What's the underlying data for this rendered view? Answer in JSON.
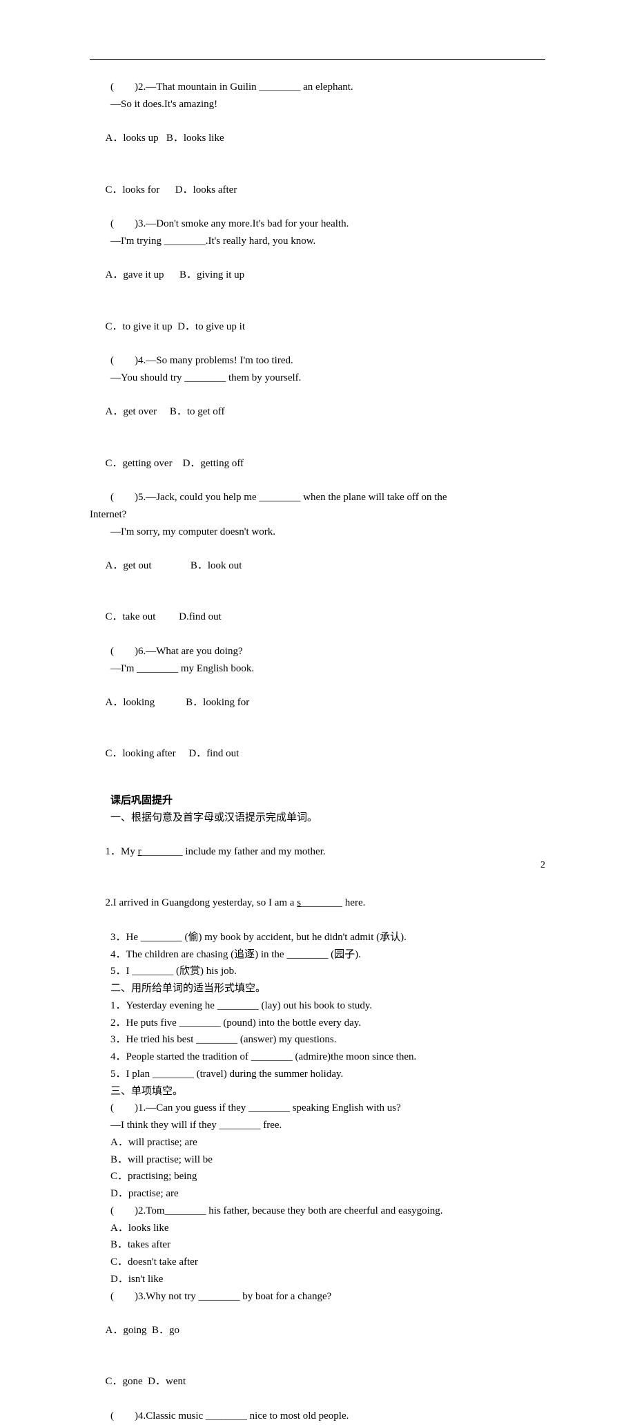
{
  "page_number": "2",
  "section_a": {
    "q2": {
      "stem": "(　　)2.—That mountain in Guilin ________ an elephant.",
      "resp": "—So it does.It's amazing!",
      "a": "A．looks up",
      "b": "B．looks like",
      "c": "C．looks for",
      "d": "D．looks after"
    },
    "q3": {
      "stem": "(　　)3.—Don't smoke any more.It's bad for your health.",
      "resp": "—I'm trying ________.It's really hard, you know.",
      "a": "A．gave it up",
      "b": "B．giving it up",
      "c": "C．to give it up",
      "d": "D．to give up it"
    },
    "q4": {
      "stem": "(　　)4.—So many problems! I'm too tired.",
      "resp": "—You should try ________ them by yourself.",
      "a": "A．get over",
      "b": "B．to get off",
      "c": "C．getting over",
      "d": "D．getting off"
    },
    "q5": {
      "stem": "(　　)5.—Jack, could you help me ________ when the plane will take off on the",
      "stem2": "Internet?",
      "resp": "—I'm sorry, my computer doesn't work.",
      "a": "A．get out",
      "b": "B．look out",
      "c": "C．take out",
      "d": "D.find out"
    },
    "q6": {
      "stem": "(　　)6.—What are you doing?",
      "resp": "—I'm ________ my English book.",
      "a": "A．looking",
      "b": "B．looking for",
      "c": "C．looking after",
      "d": "D．find out"
    }
  },
  "section_b": {
    "heading": "课后巩固提升",
    "part1": {
      "title": "一、根据句意及首字母或汉语提示完成单词。",
      "q1_pre": "1．My ",
      "q1_u": "r",
      "q1_post": "________ include my father and my mother.",
      "q2_pre": "2.I arrived in Guangdong yesterday, so I am a ",
      "q2_u": "s",
      "q2_post": "________ here.",
      "q3": "3．He ________ (偷) my book by accident, but he didn't admit (承认).",
      "q4": "4．The children are chasing (追逐) in the ________ (园子).",
      "q5": "5．I ________ (欣赏) his job."
    },
    "part2": {
      "title": "二、用所给单词的适当形式填空。",
      "q1": "1．Yesterday evening he ________ (lay) out his book to study.",
      "q2": "2．He puts five ________ (pound) into the bottle every day.",
      "q3": "3．He tried his best ________ (answer) my questions.",
      "q4": "4．People started the tradition of ________ (admire)the moon since then.",
      "q5": "5．I plan ________ (travel) during the summer holiday."
    },
    "part3": {
      "title": "三、单项填空。",
      "q1": {
        "stem": "(　　)1.—Can you guess if they ________ speaking English with us?",
        "resp": "—I think they will if they ________ free.",
        "a": "A．will practise; are",
        "b": "B．will practise; will be",
        "c": "C．practising; being",
        "d": "D．practise; are"
      },
      "q2": {
        "stem": "(　　)2.Tom________ his father, because they both are cheerful and easygoing.",
        "a": "A．looks like",
        "b": "B．takes after",
        "c": "C．doesn't take after",
        "d": "D．isn't like"
      },
      "q3": {
        "stem": "(　　)3.Why not try ________ by boat for a change?",
        "a": "A．going",
        "b": "B．go",
        "c": "C．gone",
        "d": "D．went"
      },
      "q4": {
        "stem": "(　　)4.Classic music ________ nice to most old people."
      }
    }
  }
}
